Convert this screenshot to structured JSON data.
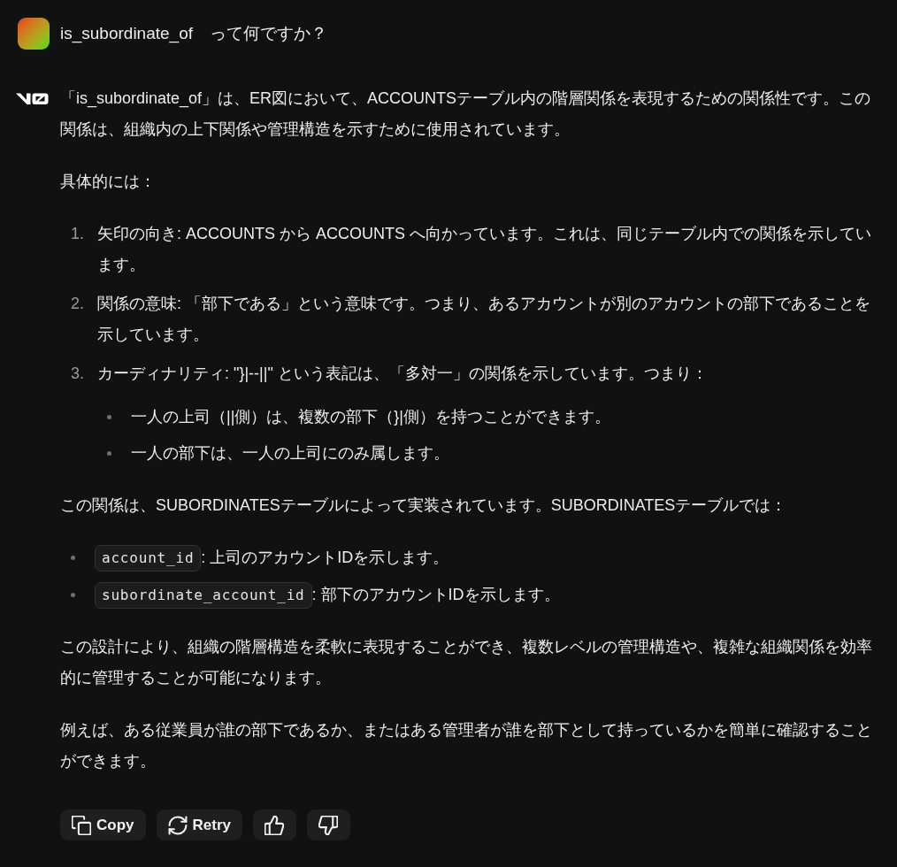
{
  "user_message": {
    "text": "is_subordinate_of　って何ですか？"
  },
  "response": {
    "blocks": [
      {
        "kind": "paragraph",
        "text": "「is_subordinate_of」は、ER図において、ACCOUNTSテーブル内の階層関係を表現するための関係性です。この関係は、組織内の上下関係や管理構造を示すために使用されています。"
      },
      {
        "kind": "paragraph",
        "text": "具体的には："
      },
      {
        "kind": "ordered_list",
        "items": [
          {
            "number": "1.",
            "text": "矢印の向き: ACCOUNTS から ACCOUNTS へ向かっています。これは、同じテーブル内での関係を示しています。"
          },
          {
            "number": "2.",
            "text": "関係の意味: 「部下である」という意味です。つまり、あるアカウントが別のアカウントの部下であることを示しています。"
          },
          {
            "number": "3.",
            "text": "カーディナリティ: \"}|--||\" という表記は、「多対一」の関係を示しています。つまり：",
            "children": [
              {
                "text": "一人の上司（||側）は、複数の部下（}|側）を持つことができます。"
              },
              {
                "text": "一人の部下は、一人の上司にのみ属します。"
              }
            ]
          }
        ]
      },
      {
        "kind": "paragraph",
        "text": "この関係は、SUBORDINATESテーブルによって実装されています。SUBORDINATESテーブルでは："
      },
      {
        "kind": "bullet_list",
        "items": [
          {
            "code": "account_id",
            "text": ": 上司のアカウントIDを示します。"
          },
          {
            "code": "subordinate_account_id",
            "text": ": 部下のアカウントIDを示します。"
          }
        ]
      },
      {
        "kind": "paragraph",
        "text": "この設計により、組織の階層構造を柔軟に表現することができ、複数レベルの管理構造や、複雑な組織関係を効率的に管理することが可能になります。"
      },
      {
        "kind": "paragraph",
        "text": "例えば、ある従業員が誰の部下であるか、またはある管理者が誰を部下として持っているかを簡単に確認することができます。"
      }
    ]
  },
  "actions": [
    {
      "kind": "copy",
      "label": "Copy"
    },
    {
      "kind": "retry",
      "label": "Retry"
    },
    {
      "kind": "thumbs_up"
    },
    {
      "kind": "thumbs_down"
    }
  ]
}
